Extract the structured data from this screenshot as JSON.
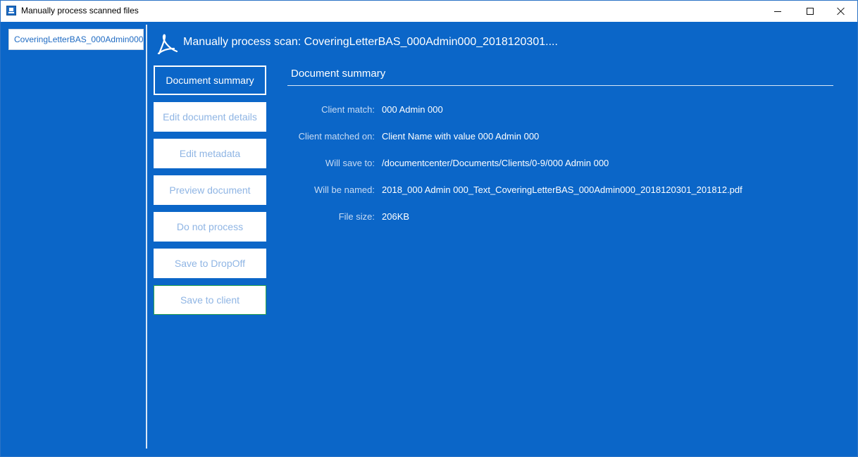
{
  "window": {
    "title": "Manually process scanned files",
    "icon": "scanner-app-icon"
  },
  "sidebar": {
    "files": [
      {
        "label": "CoveringLetterBAS_000Admin000..."
      }
    ]
  },
  "header": {
    "icon": "pdf-icon",
    "title": "Manually process scan: CoveringLetterBAS_000Admin000_2018120301...."
  },
  "actions": [
    {
      "label": "Document summary",
      "state": "active"
    },
    {
      "label": "Edit document details",
      "state": "normal"
    },
    {
      "label": "Edit metadata",
      "state": "normal"
    },
    {
      "label": "Preview document",
      "state": "normal"
    },
    {
      "label": "Do not process",
      "state": "normal"
    },
    {
      "label": "Save to DropOff",
      "state": "normal"
    },
    {
      "label": "Save to client",
      "state": "highlighted"
    }
  ],
  "summary": {
    "title": "Document summary",
    "rows": [
      {
        "label": "Client match:",
        "value": "000 Admin 000"
      },
      {
        "label": "Client matched on:",
        "value": "Client Name with value 000 Admin 000"
      },
      {
        "label": "Will save to:",
        "value": "/documentcenter/Documents/Clients/0-9/000 Admin 000"
      },
      {
        "label": "Will be named:",
        "value": "2018_000 Admin 000_Text_CoveringLetterBAS_000Admin000_2018120301_201812.pdf"
      },
      {
        "label": "File size:",
        "value": "206KB"
      }
    ]
  },
  "colors": {
    "background": "#0b66c8",
    "accent_border": "#2ea64d",
    "button_text": "#8fb5e4"
  }
}
